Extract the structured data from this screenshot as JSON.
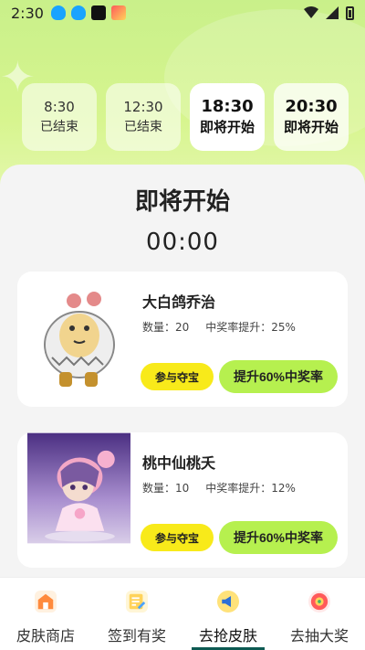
{
  "status_bar": {
    "time": "2:30"
  },
  "time_slots": [
    {
      "time": "8:30",
      "status": "已结束",
      "state": "ended"
    },
    {
      "time": "12:30",
      "status": "已结束",
      "state": "ended"
    },
    {
      "time": "18:30",
      "status": "即将开始",
      "state": "active"
    },
    {
      "time": "20:30",
      "status": "即将开始",
      "state": "upcoming"
    }
  ],
  "section": {
    "title": "即将开始",
    "countdown": "00:00"
  },
  "prizes": [
    {
      "name": "大白鸽乔治",
      "quantity_label": "数量：20",
      "boost_label": "中奖率提升：25%",
      "join_label": "参与夺宝",
      "boost_button_label": "提升60%中奖率"
    },
    {
      "name": "桃中仙桃夭",
      "quantity_label": "数量：10",
      "boost_label": "中奖率提升：12%",
      "join_label": "参与夺宝",
      "boost_button_label": "提升60%中奖率"
    }
  ],
  "tabs": [
    {
      "label": "皮肤商店",
      "icon": "shop-icon"
    },
    {
      "label": "签到有奖",
      "icon": "checkin-icon"
    },
    {
      "label": "去抢皮肤",
      "icon": "megaphone-icon",
      "active": true
    },
    {
      "label": "去抽大奖",
      "icon": "lottery-icon"
    }
  ],
  "colors": {
    "accent_green": "#b6f04f",
    "join_yellow": "#f8ea1a",
    "hero_green": "#c9f08a",
    "tab_indicator": "#0d5a52"
  }
}
